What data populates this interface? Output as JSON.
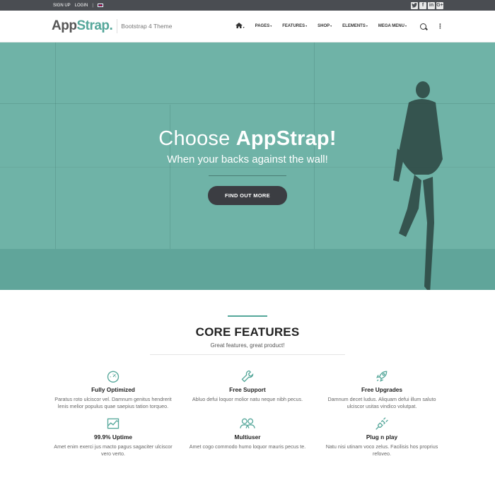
{
  "topbar": {
    "signup": "Sign Up",
    "login": "Login",
    "separator": "|",
    "social": [
      "twitter-icon",
      "facebook-icon",
      "linkedin-icon",
      "google-plus-icon"
    ]
  },
  "brand": {
    "name_part1": "App",
    "name_part2": "Strap.",
    "tagline": "Bootstrap 4 Theme",
    "accent_color": "#55a79a"
  },
  "nav": {
    "items": [
      "Pages",
      "Features",
      "Shop",
      "Elements",
      "Mega Menu"
    ]
  },
  "hero": {
    "title_light": "Choose ",
    "title_bold": "AppStrap!",
    "subtitle": "When your backs against the wall!",
    "button": "Find Out More",
    "overlay_color": "#6fb3a7"
  },
  "features": {
    "title": "CORE FEATURES",
    "subtitle": "Great features, great product!",
    "items": [
      {
        "title": "Fully Optimized",
        "text": "Paratus roto ulciscor vel. Damnum genitus hendrerit lenis melior populus quae saepius tation torqueo.",
        "icon": "speedometer-icon"
      },
      {
        "title": "Free Support",
        "text": "Abluo defui loquor molior natu neque nibh pecus.",
        "icon": "wrench-icon"
      },
      {
        "title": "Free Upgrades",
        "text": "Damnum decet ludus. Aliquam defui illum saluto ulciscor usitas vindico volutpat.",
        "icon": "rocket-icon"
      },
      {
        "title": "99.9% Uptime",
        "text": "Amet enim exerci jus macto pagus sagaciter ulciscor vero verto.",
        "icon": "chart-icon"
      },
      {
        "title": "Multiuser",
        "text": "Amet cogo commodo humo loquor mauris pecus te.",
        "icon": "users-icon"
      },
      {
        "title": "Plug n play",
        "text": "Natu nisi utinam voco zelus. Facilisis hos proprius refoveo.",
        "icon": "plug-icon"
      }
    ]
  }
}
